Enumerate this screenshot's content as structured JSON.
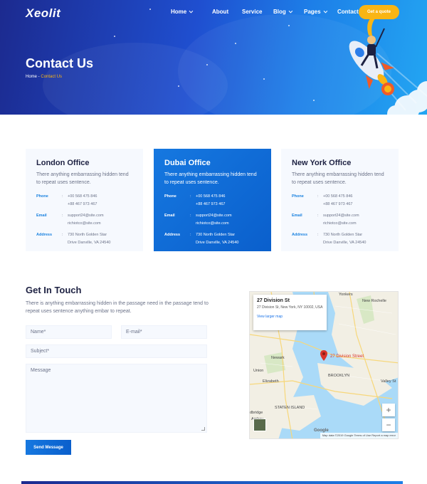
{
  "header": {
    "logo": "Xeolit",
    "nav": [
      {
        "label": "Home",
        "dropdown": true
      },
      {
        "label": "About",
        "dropdown": false
      },
      {
        "label": "Service",
        "dropdown": false
      },
      {
        "label": "Blog",
        "dropdown": true
      },
      {
        "label": "Pages",
        "dropdown": true
      },
      {
        "label": "Contact",
        "dropdown": false
      }
    ],
    "cta": "Get a quote"
  },
  "hero": {
    "title": "Contact Us",
    "breadcrumb_home": "Home",
    "breadcrumb_sep": " - ",
    "breadcrumb_current": "Contact Us"
  },
  "offices": [
    {
      "name": "London Office",
      "desc": "There anything embarrassing hidden tend to repeat uses sentence.",
      "phone_label": "Phone",
      "phone1": "+00 568 475 846",
      "phone2": "+88 467 973 467",
      "email_label": "Email",
      "email1": "support24@site.com",
      "email2": "richiotco@site.com",
      "address_label": "Address",
      "address1": "730 North Golden Star",
      "address2": "Drive Danville, VA 24540",
      "sep": ":"
    },
    {
      "name": "Dubai Office",
      "desc": "There anything embarrassing hidden tend to repeat uses sentence.",
      "phone_label": "Phone",
      "phone1": "+00 568 475 846",
      "phone2": "+88 467 973 467",
      "email_label": "Email",
      "email1": "support24@site.com",
      "email2": "richiotco@site.com",
      "address_label": "Address",
      "address1": "730 North Golden Star",
      "address2": "Drive Danville, VA 24540",
      "sep": ":"
    },
    {
      "name": "New York Office",
      "desc": "There anything embarrassing hidden tend to repeat uses sentence.",
      "phone_label": "Phone",
      "phone1": "+00 568 475 846",
      "phone2": "+88 467 973 467",
      "email_label": "Email",
      "email1": "support24@site.com",
      "email2": "richiotco@site.com",
      "address_label": "Address",
      "address1": "730 North Golden Star",
      "address2": "Drive Danville, VA 24540",
      "sep": ":"
    }
  ],
  "form": {
    "title": "Get In Touch",
    "desc": "There is anything embarrassing hidden in the passage need in the passage tend to repeat uses sentence anything embar to repeat.",
    "name_placeholder": "Name*",
    "email_placeholder": "E-mail*",
    "subject_placeholder": "Subject*",
    "message_placeholder": "Message",
    "submit": "Send Message"
  },
  "map": {
    "info_title": "27 Division St",
    "info_address": "27 Division St, New York, NY 10002, USA",
    "info_link": "View larger map",
    "pin_label": "27 Division Street",
    "labels": [
      "Yonkers",
      "New Rochelle",
      "Newark",
      "Union",
      "Elizabeth",
      "BROOKLYN",
      "Valley St",
      "STATEN ISLAND",
      "dbridge",
      "Amboy"
    ],
    "zoom_in": "+",
    "zoom_out": "−",
    "google": "Google",
    "footer": "Map data ©2019 Google   Terms of Use   Report a map error",
    "colors": {
      "water": "#aadaf8",
      "land": "#f2efe4",
      "pin": "#d9342b"
    }
  }
}
